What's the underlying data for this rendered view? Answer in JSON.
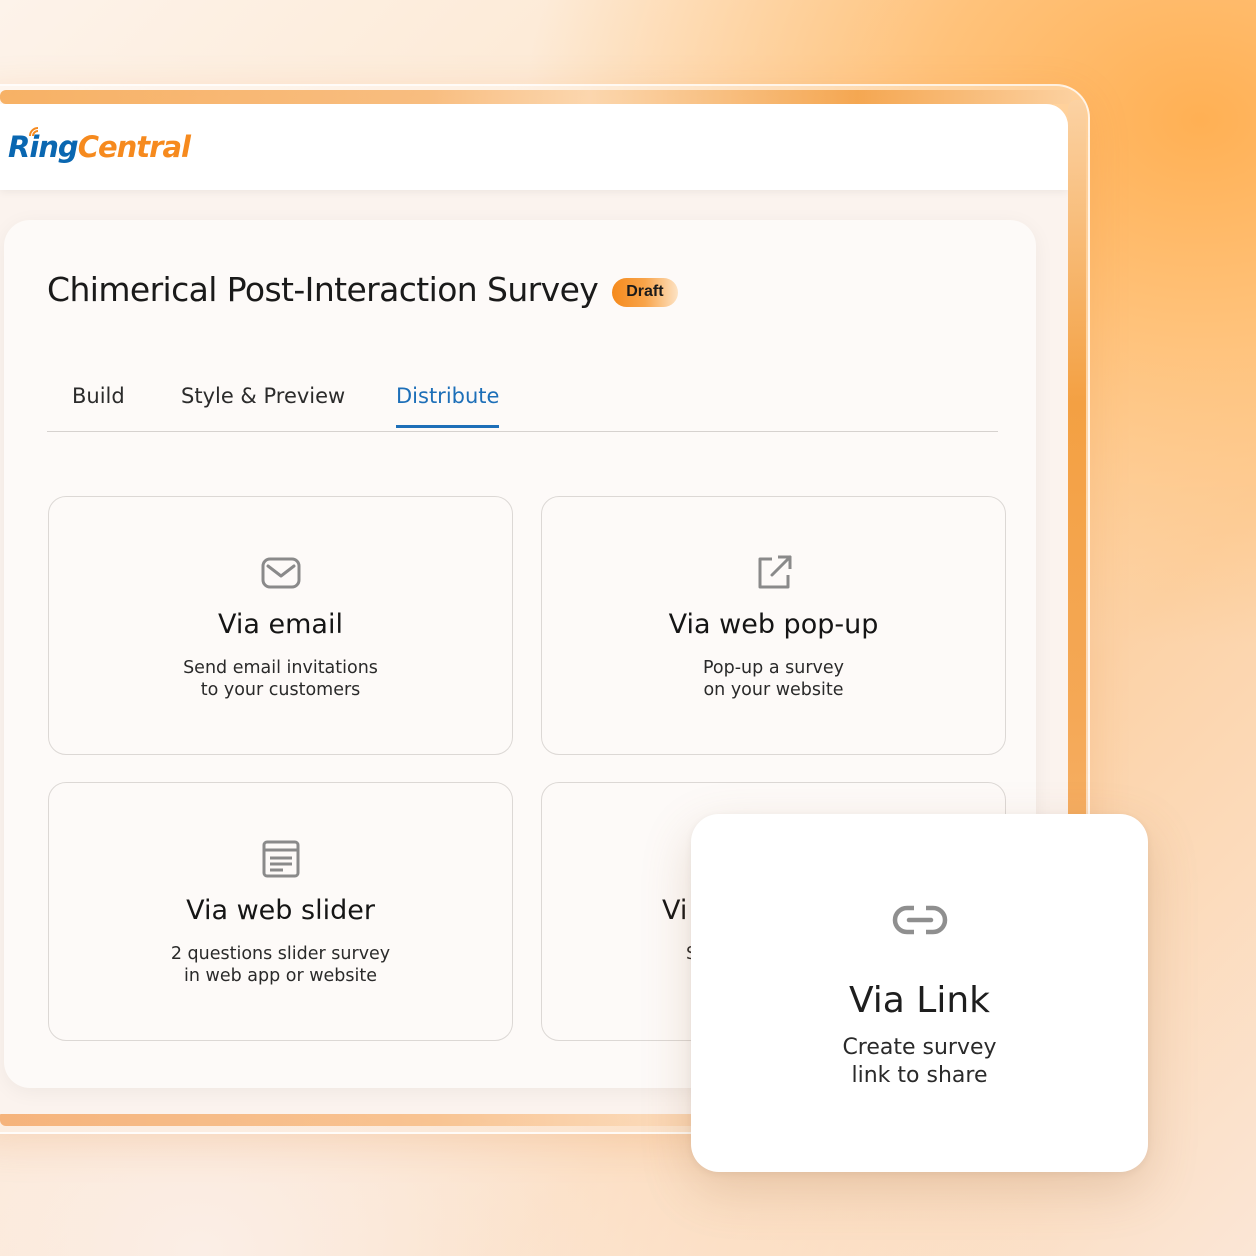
{
  "app": {
    "logo_ring": "Ring",
    "logo_central": "Central",
    "brand_colors": {
      "blue": "#0a67b1",
      "orange": "#f68a1e"
    }
  },
  "survey": {
    "title": "Chimerical Post-Interaction Survey",
    "status_badge": "Draft"
  },
  "tabs": [
    {
      "label": "Build",
      "active": false
    },
    {
      "label": "Style & Preview",
      "active": false
    },
    {
      "label": "Distribute",
      "active": true
    }
  ],
  "accent_color": "#1d6fb8",
  "options": [
    {
      "icon": "envelope-icon",
      "title": "Via email",
      "desc_line1": "Send email invitations",
      "desc_line2": "to your customers"
    },
    {
      "icon": "external-link-icon",
      "title": "Via web pop-up",
      "desc_line1": "Pop-up a survey",
      "desc_line2": "on your website"
    },
    {
      "icon": "document-list-icon",
      "title": "Via web slider",
      "desc_line1": "2 questions slider survey",
      "desc_line2": "in web app or website"
    },
    {
      "icon": "",
      "title": "Vi",
      "desc_line1": "S",
      "desc_line2": ""
    }
  ],
  "link_card": {
    "icon": "link-icon",
    "title": "Via Link",
    "desc_line1": "Create survey",
    "desc_line2": "link to share"
  }
}
